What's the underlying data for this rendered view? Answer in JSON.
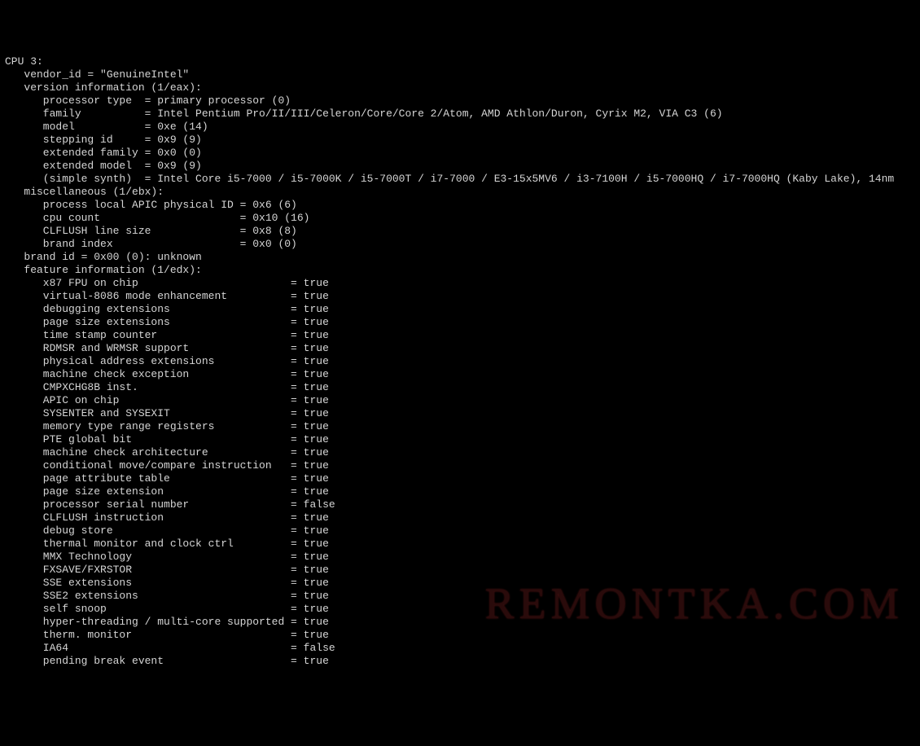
{
  "cpu_header": "CPU 3:",
  "vendor_line": "   vendor_id = \"GenuineIntel\"",
  "version_head": "   version information (1/eax):",
  "version_rows": [
    {
      "k": "processor type",
      "v": "primary processor (0)"
    },
    {
      "k": "family",
      "v": "Intel Pentium Pro/II/III/Celeron/Core/Core 2/Atom, AMD Athlon/Duron, Cyrix M2, VIA C3 (6)"
    },
    {
      "k": "model",
      "v": "0xe (14)"
    },
    {
      "k": "stepping id",
      "v": "0x9 (9)"
    },
    {
      "k": "extended family",
      "v": "0x0 (0)"
    },
    {
      "k": "extended model",
      "v": "0x9 (9)"
    },
    {
      "k": "(simple synth)",
      "v": "Intel Core i5-7000 / i5-7000K / i5-7000T / i7-7000 / E3-15x5MV6 / i3-7100H / i5-7000HQ / i7-7000HQ (Kaby Lake), 14nm"
    }
  ],
  "misc_head": "   miscellaneous (1/ebx):",
  "misc_rows": [
    {
      "k": "process local APIC physical ID",
      "v": "0x6 (6)"
    },
    {
      "k": "cpu count",
      "v": "0x10 (16)"
    },
    {
      "k": "CLFLUSH line size",
      "v": "0x8 (8)"
    },
    {
      "k": "brand index",
      "v": "0x0 (0)"
    }
  ],
  "brand_line": "   brand id = 0x00 (0): unknown",
  "feature_head": "   feature information (1/edx):",
  "feature_rows": [
    {
      "k": "x87 FPU on chip",
      "v": "true"
    },
    {
      "k": "virtual-8086 mode enhancement",
      "v": "true"
    },
    {
      "k": "debugging extensions",
      "v": "true"
    },
    {
      "k": "page size extensions",
      "v": "true"
    },
    {
      "k": "time stamp counter",
      "v": "true"
    },
    {
      "k": "RDMSR and WRMSR support",
      "v": "true"
    },
    {
      "k": "physical address extensions",
      "v": "true"
    },
    {
      "k": "machine check exception",
      "v": "true"
    },
    {
      "k": "CMPXCHG8B inst.",
      "v": "true"
    },
    {
      "k": "APIC on chip",
      "v": "true"
    },
    {
      "k": "SYSENTER and SYSEXIT",
      "v": "true"
    },
    {
      "k": "memory type range registers",
      "v": "true"
    },
    {
      "k": "PTE global bit",
      "v": "true"
    },
    {
      "k": "machine check architecture",
      "v": "true"
    },
    {
      "k": "conditional move/compare instruction",
      "v": "true"
    },
    {
      "k": "page attribute table",
      "v": "true"
    },
    {
      "k": "page size extension",
      "v": "true"
    },
    {
      "k": "processor serial number",
      "v": "false"
    },
    {
      "k": "CLFLUSH instruction",
      "v": "true"
    },
    {
      "k": "debug store",
      "v": "true"
    },
    {
      "k": "thermal monitor and clock ctrl",
      "v": "true"
    },
    {
      "k": "MMX Technology",
      "v": "true"
    },
    {
      "k": "FXSAVE/FXRSTOR",
      "v": "true"
    },
    {
      "k": "SSE extensions",
      "v": "true"
    },
    {
      "k": "SSE2 extensions",
      "v": "true"
    },
    {
      "k": "self snoop",
      "v": "true"
    },
    {
      "k": "hyper-threading / multi-core supported",
      "v": "true"
    },
    {
      "k": "therm. monitor",
      "v": "true"
    },
    {
      "k": "IA64",
      "v": "false"
    },
    {
      "k": "pending break event",
      "v": "true"
    }
  ],
  "col_widths": {
    "version_key": 15,
    "misc_key": 30,
    "feature_key": 38
  },
  "indent": {
    "section": "   ",
    "item": "      "
  },
  "watermark": "REMONTKA.COM"
}
